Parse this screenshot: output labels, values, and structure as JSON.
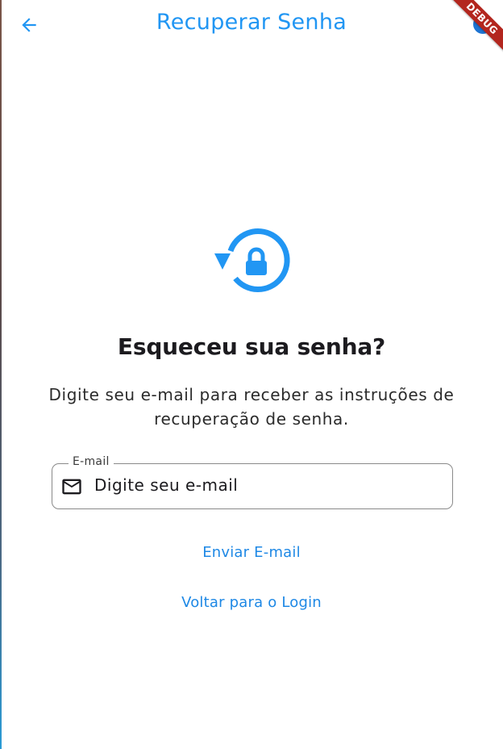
{
  "appbar": {
    "title": "Recuperar Senha",
    "back_icon": "arrow-back-icon"
  },
  "debug_banner": {
    "label": "DEBUG"
  },
  "hero": {
    "icon": "lock-reset-icon",
    "color": "#2196f3"
  },
  "main": {
    "heading": "Esqueceu sua senha?",
    "description": "Digite seu e-mail para receber as instruções de recuperação de senha."
  },
  "email_field": {
    "label": "E-mail",
    "placeholder": "Digite seu e-mail",
    "icon": "mail-icon"
  },
  "actions": {
    "send_label": "Enviar E-mail",
    "back_label": "Voltar para o Login"
  },
  "colors": {
    "accent": "#2196f3",
    "link": "#1e88e5",
    "text": "#1c1b1f"
  }
}
